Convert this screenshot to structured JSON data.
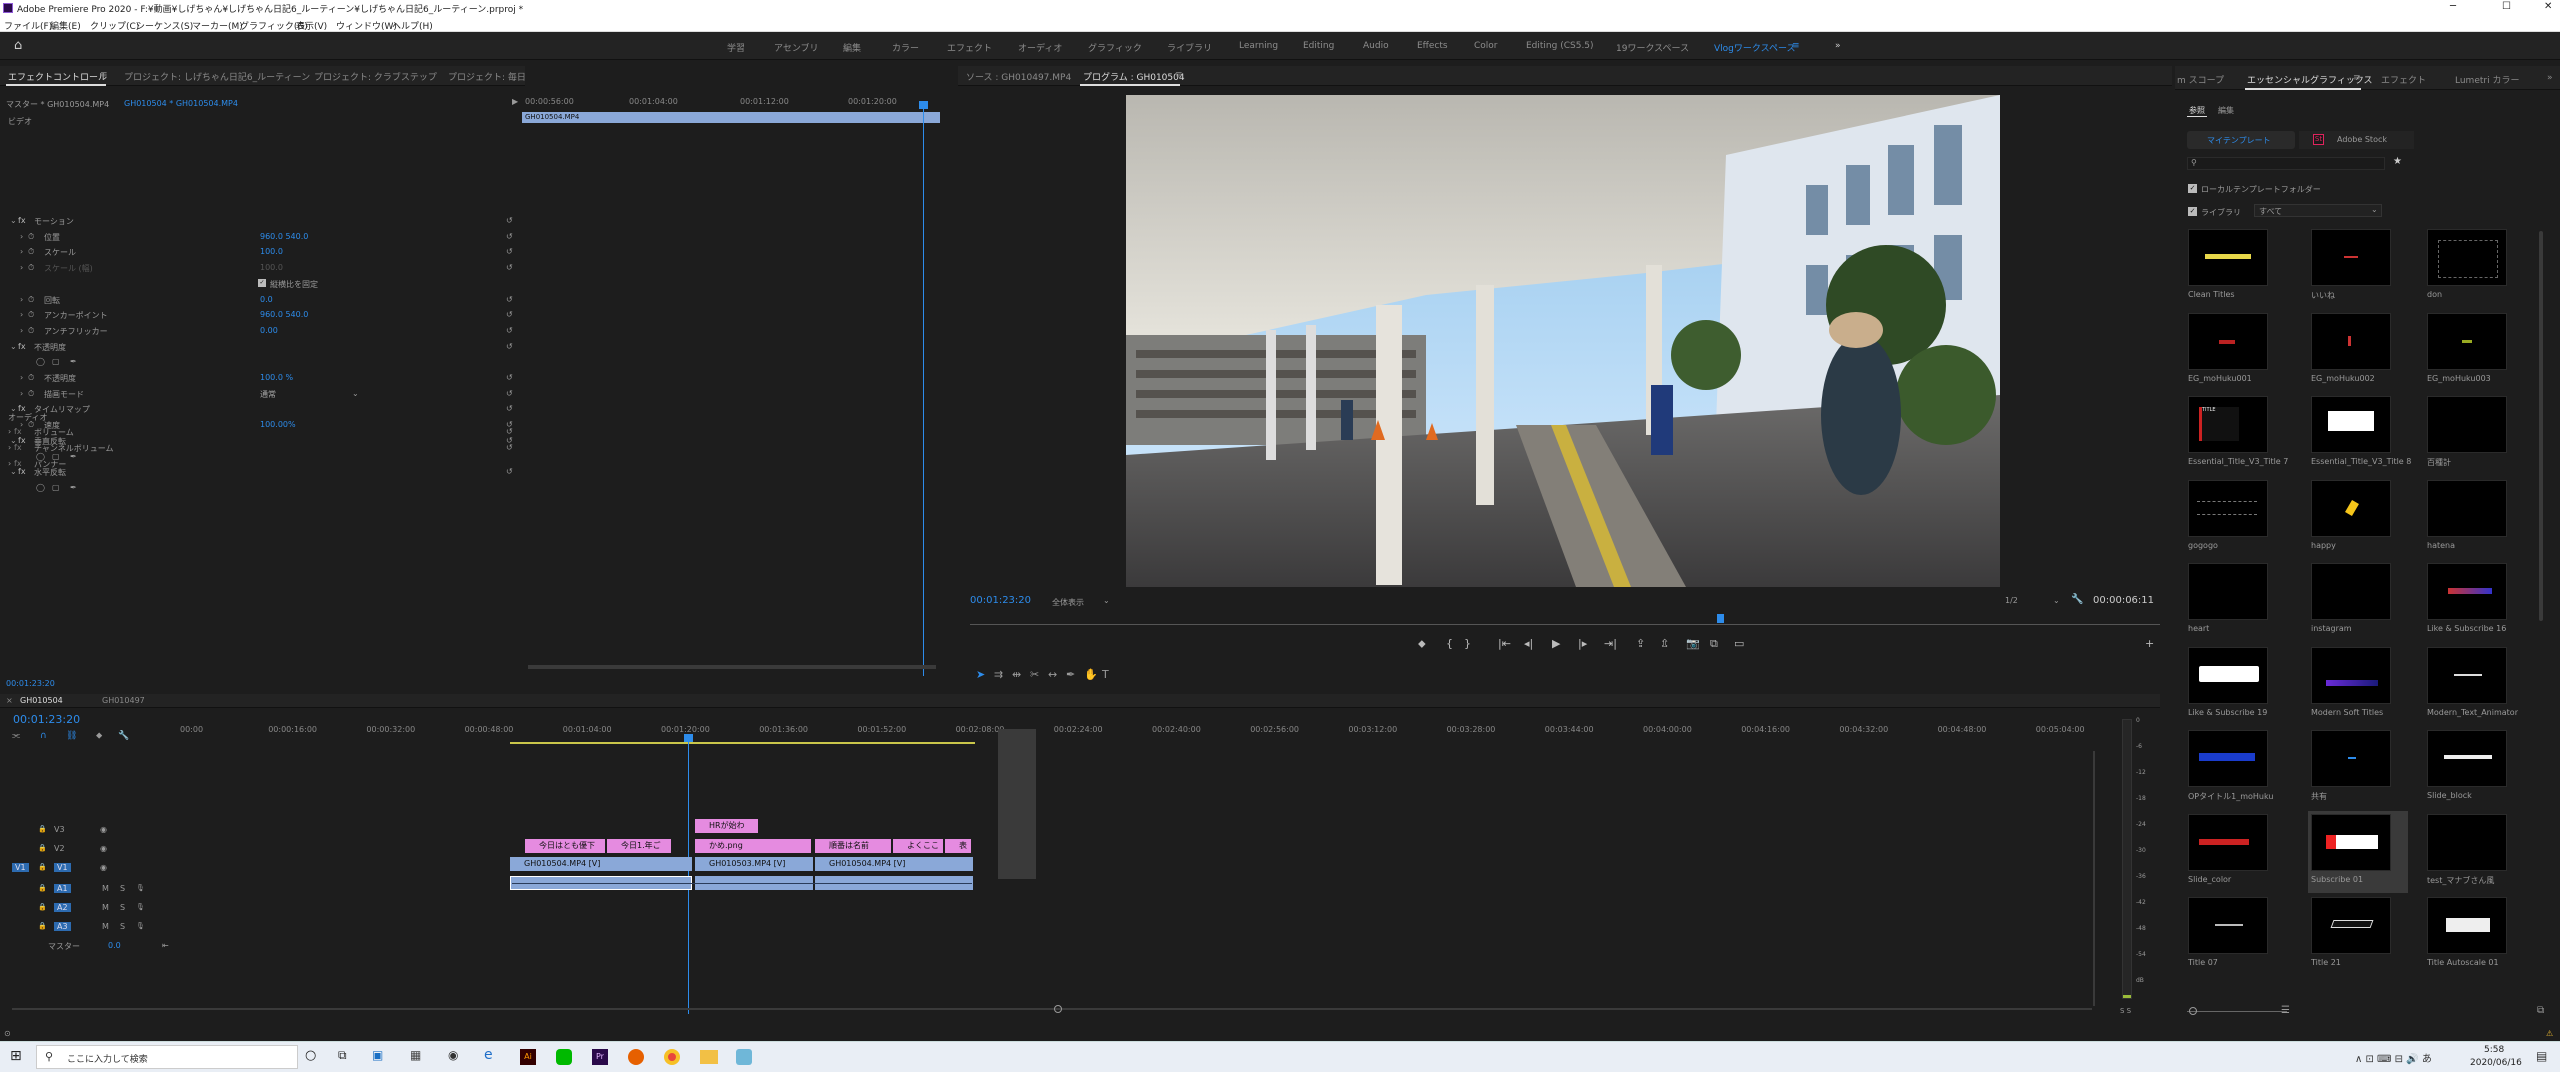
{
  "title_bar": {
    "title": "Adobe Premiere Pro 2020 - F:¥動画¥しげちゃん¥しげちゃん日記6_ルーティーン¥しげちゃん日記6_ルーティーン.prproj *",
    "min": "─",
    "max": "☐",
    "close": "✕"
  },
  "menu": [
    "ファイル(F)",
    "編集(E)",
    "クリップ(C)",
    "シーケンス(S)",
    "マーカー(M)",
    "グラフィック(G)",
    "表示(V)",
    "ウィンドウ(W)",
    "ヘルプ(H)"
  ],
  "workspaces": [
    "学習",
    "アセンブリ",
    "編集",
    "カラー",
    "エフェクト",
    "オーディオ",
    "グラフィック",
    "ライブラリ",
    "Learning",
    "Editing",
    "Audio",
    "Effects",
    "Color",
    "Editing (CS5.5)",
    "19ワークスペース",
    "Vlogワークスペース"
  ],
  "workspace_active_index": 15,
  "left_panel": {
    "tabs": [
      "エフェクトコントロール",
      "プロジェクト: しげちゃん日記6_ルーティーン",
      "プロジェクト: クラブステップ",
      "プロジェクト: 毎日"
    ],
    "source_line": {
      "master": "マスター * GH010504.MP4",
      "seq": "GH010504 * GH010504.MP4"
    },
    "ruler": [
      "00:00:56:00",
      "00:01:04:00",
      "00:01:12:00",
      "00:01:20:00"
    ],
    "clip_label": "GH010504.MP4",
    "sections": {
      "video": "ビデオ",
      "audio": "オーディオ"
    },
    "rows": [
      {
        "label": "モーション",
        "value": "",
        "indent": 1,
        "fx": true
      },
      {
        "label": "位置",
        "value": "960.0    540.0",
        "indent": 3
      },
      {
        "label": "スケール",
        "value": "100.0",
        "indent": 3
      },
      {
        "label": "スケール (幅)",
        "value": "100.0",
        "indent": 3,
        "dim": true
      },
      {
        "label": "",
        "value": "縦横比を固定",
        "indent": 3,
        "check": true
      },
      {
        "label": "回転",
        "value": "0.0",
        "indent": 3
      },
      {
        "label": "アンカーポイント",
        "value": "960.0    540.0",
        "indent": 3
      },
      {
        "label": "アンチフリッカー",
        "value": "0.00",
        "indent": 3
      },
      {
        "label": "不透明度",
        "value": "",
        "indent": 1,
        "fx": true
      },
      {
        "label": "",
        "value": "",
        "indent": 3,
        "shapes": true
      },
      {
        "label": "不透明度",
        "value": "100.0 %",
        "indent": 3
      },
      {
        "label": "描画モード",
        "value": "通常",
        "indent": 3,
        "select": true
      },
      {
        "label": "タイムリマップ",
        "value": "",
        "indent": 1,
        "fx": true
      },
      {
        "label": "速度",
        "value": "100.00%",
        "indent": 3
      },
      {
        "label": "垂直反転",
        "value": "",
        "indent": 1,
        "fx": true
      },
      {
        "label": "",
        "value": "",
        "indent": 3,
        "shapes": true
      },
      {
        "label": "水平反転",
        "value": "",
        "indent": 1,
        "fx": true
      },
      {
        "label": "",
        "value": "",
        "indent": 3,
        "shapes": true
      }
    ],
    "audio_rows": [
      "ボリューム",
      "チャンネルボリューム",
      "パンナー"
    ],
    "timecode": "00:01:23:20"
  },
  "program_monitor": {
    "tabs": [
      "ソース : GH010497.MP4",
      "プログラム : GH010504"
    ],
    "timecode": "00:01:23:20",
    "fit": "全体表示",
    "quality": "1/2",
    "duration": "00:00:06:11",
    "controls": [
      "マーカー",
      "インをマーク",
      "アウトをマーク",
      "インへ移動",
      "1フレーム戻る",
      "再生",
      "1フレーム進む",
      "アウトへ移動",
      "リフト",
      "抽出",
      "フレームを書き出し",
      "比較表示",
      "セーフマージン"
    ],
    "progress_pct": 0.63
  },
  "timeline": {
    "tabs": [
      "GH010504",
      "GH010497"
    ],
    "timecode": "00:01:23:20",
    "ruler": [
      "00:00",
      "00:00:16:00",
      "00:00:32:00",
      "00:00:48:00",
      "00:01:04:00",
      "00:01:20:00",
      "00:01:36:00",
      "00:01:52:00",
      "00:02:08:00",
      "00:02:24:00",
      "00:02:40:00",
      "00:02:56:00",
      "00:03:12:00",
      "00:03:28:00",
      "00:03:44:00",
      "00:04:00:00",
      "00:04:16:00",
      "00:04:32:00",
      "00:04:48:00",
      "00:05:04:00"
    ],
    "tracks": [
      {
        "name": "V3",
        "lock": "🔒",
        "eye": "◉"
      },
      {
        "name": "V2",
        "lock": "🔒",
        "eye": "◉"
      },
      {
        "name": "V1",
        "lock": "🔒",
        "eye": "◉",
        "target": "V1"
      },
      {
        "name": "A1",
        "lock": "🔒",
        "m": "M",
        "s": "S",
        "mic": "🎙"
      },
      {
        "name": "A2",
        "lock": "🔒",
        "m": "M",
        "s": "S",
        "mic": "🎙"
      },
      {
        "name": "A3",
        "lock": "🔒",
        "m": "M",
        "s": "S",
        "mic": "🎙"
      }
    ],
    "master_label": "マスター",
    "master_value": "0.0",
    "clips": {
      "v3": [
        {
          "label": "HRが始わ",
          "color": "#e58be0"
        }
      ],
      "v2": [
        {
          "label": "今日はとも優下",
          "color": "#e58be0"
        },
        {
          "label": "今日1.年ご",
          "color": "#e58be0"
        },
        {
          "label": "かめ.png",
          "color": "#e58be0"
        },
        {
          "label": "順番は名前",
          "color": "#e58be0"
        },
        {
          "label": "よくここ",
          "color": "#e58be0"
        },
        {
          "label": "表",
          "color": "#e58be0"
        }
      ],
      "v1": [
        {
          "label": "GH010504.MP4 [V]",
          "color": "#8aa8d8"
        },
        {
          "label": "GH010503.MP4 [V]",
          "color": "#8aa8d8"
        },
        {
          "label": "GH010504.MP4 [V]",
          "color": "#8aa8d8"
        }
      ]
    },
    "meter_labels": [
      "0",
      "-6",
      "-12",
      "-18",
      "-24",
      "-30",
      "-36",
      "-42",
      "-48",
      "-54",
      "dB"
    ],
    "meter_ss": "S  S"
  },
  "essential_graphics": {
    "tabs": [
      "m スコープ",
      "エッセンシャルグラフィックス",
      "エフェクト",
      "Lumetri カラー"
    ],
    "subtabs": [
      "参照",
      "編集"
    ],
    "mytemplates": "マイテンプレート",
    "adobestock": "Adobe Stock",
    "local_templates": "ローカルテンプレートフォルダー",
    "libraries": "ライブラリ",
    "libraries_select": "すべて",
    "templates": [
      "Clean Titles",
      "いいね",
      "don",
      "EG_moHuku001",
      "EG_moHuku002",
      "EG_moHuku003",
      "Essential_Title_V3_Title 7",
      "Essential_Title_V3_Title 8",
      "百種計",
      "gogogo",
      "happy",
      "hatena",
      "heart",
      "instagram",
      "Like & Subscribe 16",
      "Like & Subscribe 19",
      "Modern Soft Titles",
      "Modern_Text_Animator",
      "OPタイトル1_moHuku",
      "共有",
      "Slide_block",
      "Slide_color",
      "Subscribe 01",
      "test_マナブさん風",
      "Title 07",
      "Title 21",
      "Title Autoscale 01"
    ],
    "selected_index": 22
  },
  "taskbar": {
    "search": "ここに入力して検索",
    "time": "5:58",
    "date": "2020/06/16"
  },
  "colors": {
    "accent": "#2d8ceb",
    "pink_clip": "#e58be0",
    "blue_clip": "#8aa8d8",
    "panel_bg": "#1d1d1d",
    "header_bg": "#232323"
  }
}
